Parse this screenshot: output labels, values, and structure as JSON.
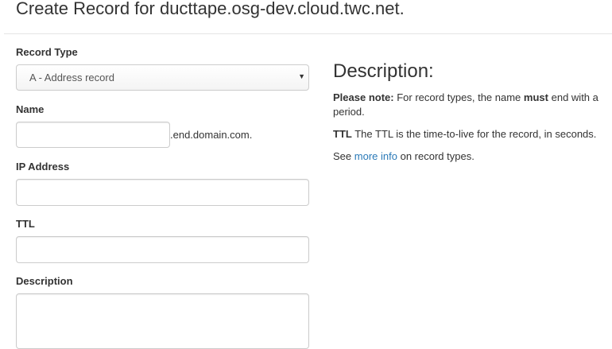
{
  "page": {
    "title": "Create Record for ducttape.osg-dev.cloud.twc.net."
  },
  "form": {
    "record_type": {
      "label": "Record Type",
      "selected": "A - Address record"
    },
    "name": {
      "label": "Name",
      "value": "",
      "suffix": ".end.domain.com."
    },
    "ip_address": {
      "label": "IP Address",
      "value": ""
    },
    "ttl": {
      "label": "TTL",
      "value": ""
    },
    "description": {
      "label": "Description",
      "value": ""
    }
  },
  "help": {
    "heading": "Description:",
    "note_label": "Please note:",
    "note_text_1": "For record types, the name",
    "note_emphasis": "must",
    "note_text_2": "end with a period.",
    "ttl_label": "TTL",
    "ttl_text": "The TTL is the time-to-live for the record, in seconds.",
    "see_prefix": "See",
    "link_text": "more info",
    "see_suffix": "on record types."
  },
  "icons": {
    "select_caret": "caret-down-icon"
  },
  "colors": {
    "link": "#2a7ab8",
    "border": "#cccccc",
    "text": "#333333"
  }
}
